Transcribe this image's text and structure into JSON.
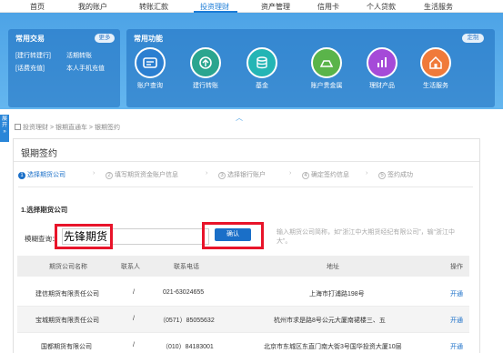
{
  "nav": {
    "items": [
      {
        "label": "首页"
      },
      {
        "label": "我的账户"
      },
      {
        "label": "转账汇款"
      },
      {
        "label": "投资理财"
      },
      {
        "label": "资产管理"
      },
      {
        "label": "信用卡"
      },
      {
        "label": "个人贷款"
      },
      {
        "label": "生活服务"
      }
    ],
    "active_index": 3
  },
  "quick_trade": {
    "title": "常用交易",
    "more_label": "更多",
    "links": [
      "[建行转建行]",
      "活期转账",
      "[话费充值]",
      "本人手机充值"
    ]
  },
  "common_functions": {
    "title": "常用功能",
    "custom_label": "定制",
    "items": [
      {
        "label": "账户查询",
        "icon": "account-query-icon",
        "color": "#2b7fd1"
      },
      {
        "label": "建行转账",
        "icon": "transfer-icon",
        "color": "#2aa58f"
      },
      {
        "label": "基金",
        "icon": "fund-icon",
        "color": "#24b5b5"
      },
      {
        "label": "账户贵金属",
        "icon": "precious-metal-icon",
        "color": "#5ab44a"
      },
      {
        "label": "理财产品",
        "icon": "wealth-product-icon",
        "color": "#a54ad8"
      },
      {
        "label": "生活服务",
        "icon": "life-service-icon",
        "color": "#f07a3a"
      }
    ]
  },
  "sidetab": {
    "label": "展开"
  },
  "breadcrumb": {
    "text": "投资理财 > 银期直通车 > 银期签约"
  },
  "page": {
    "title": "银期签约"
  },
  "steps": [
    {
      "num": "1",
      "label": "选择期货公司"
    },
    {
      "num": "2",
      "label": "填写期货资金账户信息"
    },
    {
      "num": "3",
      "label": "选择银行账户"
    },
    {
      "num": "4",
      "label": "确定签约信息"
    },
    {
      "num": "5",
      "label": "签约成功"
    }
  ],
  "section": {
    "title": "1.选择期货公司"
  },
  "query": {
    "label": "模糊查询：",
    "value": "先锋期货",
    "confirm_label": "确认",
    "hint": "输入期货公司简称，如“浙江中大期货经纪有限公司”，输“浙江中大”。"
  },
  "table": {
    "columns": [
      "期货公司名称",
      "联系人",
      "联系电话",
      "地址",
      "操作"
    ],
    "rows": [
      {
        "name": "建信期货有限责任公司",
        "contact": "/",
        "phone": "021-63024655",
        "address": "上海市打浦路198号",
        "action": "开通"
      },
      {
        "name": "宝城期货有限责任公司",
        "contact": "/",
        "phone": "（0571）85055632",
        "address": "杭州市求是路8号公元大厦南裙楼三、五",
        "action": "开通"
      },
      {
        "name": "国都期货有限公司",
        "contact": "/",
        "phone": "（010）84183001",
        "address": "北京市东城区东直门南大街3号国华投资大厦10层",
        "action": "开通"
      }
    ]
  }
}
